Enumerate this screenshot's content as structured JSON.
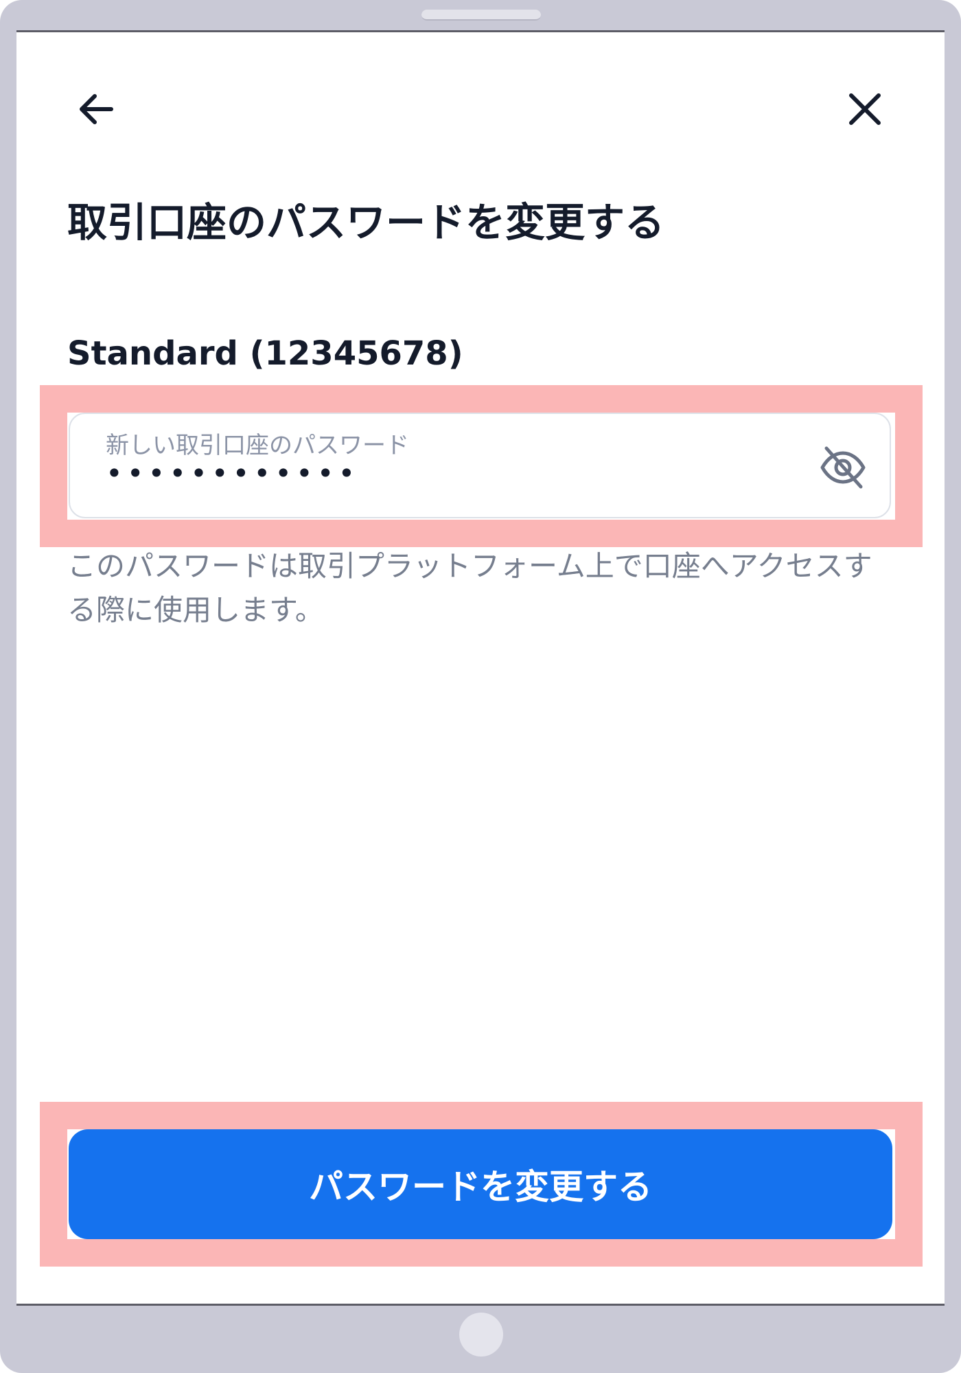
{
  "header": {
    "back_icon": "arrow-left-icon",
    "close_icon": "close-icon"
  },
  "page": {
    "title": "取引口座のパスワードを変更する",
    "account_label": "Standard (12345678)"
  },
  "password_field": {
    "label": "新しい取引口座のパスワード",
    "value_masked": "••••••••••••",
    "toggle_icon": "eye-off-icon"
  },
  "helper_text": "このパスワードは取引プラットフォーム上で口座へアクセスする際に使用します。",
  "submit": {
    "label": "パスワードを変更する"
  },
  "colors": {
    "primary_button": "#1572ee",
    "highlight": "#fbb6b6",
    "title_text": "#141b2b",
    "muted_text": "#767e8e"
  }
}
